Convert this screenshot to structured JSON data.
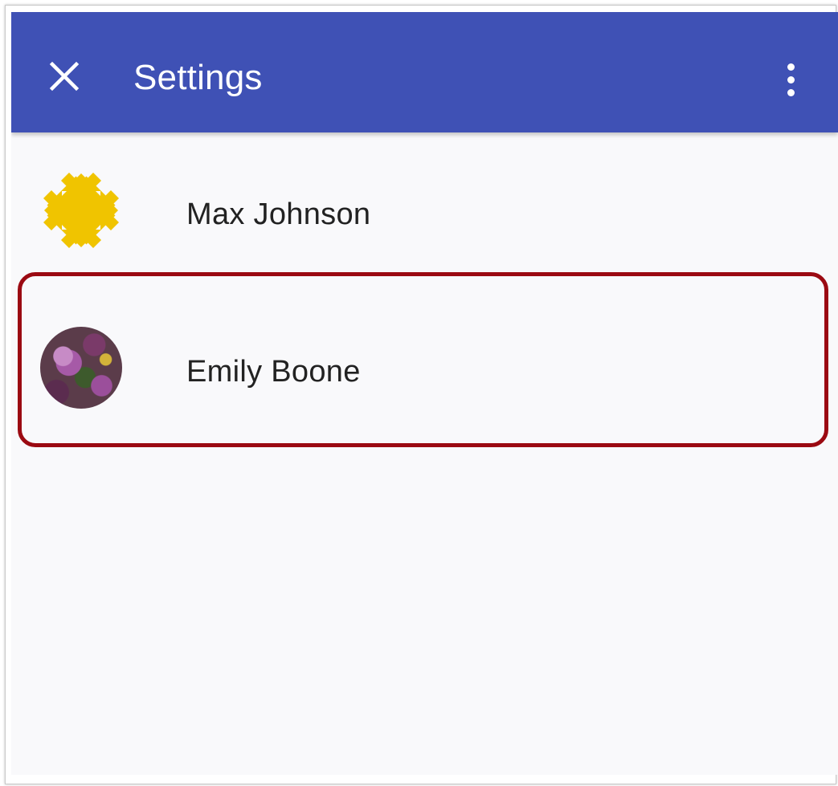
{
  "app_bar": {
    "title": "Settings",
    "close_icon": "close-icon",
    "overflow_icon": "more-vert-icon",
    "color": "#3f51b5"
  },
  "accounts": [
    {
      "name": "Max Johnson",
      "avatar_icon": "quilt-pattern-avatar",
      "avatar_color": "#f0c400"
    },
    {
      "name": "Emily Boone",
      "avatar_icon": "flower-photo-avatar"
    }
  ],
  "highlight": {
    "target": "Emily Boone",
    "color": "#9b0a12"
  }
}
